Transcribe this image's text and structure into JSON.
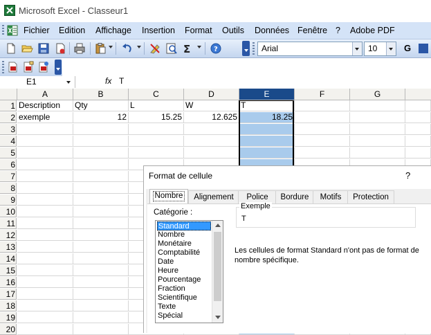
{
  "window": {
    "title": "Microsoft Excel - Classeur1"
  },
  "menu": [
    "Fichier",
    "Edition",
    "Affichage",
    "Insertion",
    "Format",
    "Outils",
    "Données",
    "Fenêtre",
    "?",
    "Adobe PDF"
  ],
  "toolbar": {
    "font_name": "Arial",
    "font_size": "10",
    "bold": "G",
    "icons": [
      "new-icon",
      "open-icon",
      "save-icon",
      "permission-icon",
      "print-icon",
      "paste-icon",
      "undo-icon",
      "clear-format-icon",
      "research-icon",
      "autosum-icon",
      "help-icon"
    ],
    "pdf_icons": [
      "convert-pdf-icon",
      "convert-pdf-attach-icon",
      "convert-pdf-review-icon"
    ]
  },
  "formula_bar": {
    "name_box": "E1",
    "fx": "fx",
    "content": "T"
  },
  "sheet": {
    "columns": [
      "A",
      "B",
      "C",
      "D",
      "E",
      "F",
      "G"
    ],
    "rows": [
      "1",
      "2",
      "3",
      "4",
      "5",
      "6",
      "7",
      "8",
      "9",
      "10",
      "11",
      "12",
      "13",
      "14",
      "15",
      "16",
      "17",
      "18",
      "19",
      "20"
    ],
    "row1": [
      "Description",
      "Qty",
      "L",
      "W",
      "T"
    ],
    "row2": [
      "exemple",
      "12",
      "15.25",
      "12.625",
      "18.25"
    ]
  },
  "dialog": {
    "title": "Format de cellule",
    "help": "?",
    "tabs": [
      "Nombre",
      "Alignement",
      "Police",
      "Bordure",
      "Motifs",
      "Protection"
    ],
    "active_tab": "Nombre",
    "category_label": "Catégorie :",
    "categories": [
      "Standard",
      "Nombre",
      "Monétaire",
      "Comptabilité",
      "Date",
      "Heure",
      "Pourcentage",
      "Fraction",
      "Scientifique",
      "Texte",
      "Spécial"
    ],
    "selected_category": "Standard",
    "example_label": "Exemple",
    "example_value": "T",
    "description": "Les cellules de format Standard n'ont pas de format de nombre spécifique."
  },
  "colors": {
    "selected_column": "#a9cbec",
    "header_selected": "#1a4a8a",
    "toolbar": "#d4e3f7"
  }
}
